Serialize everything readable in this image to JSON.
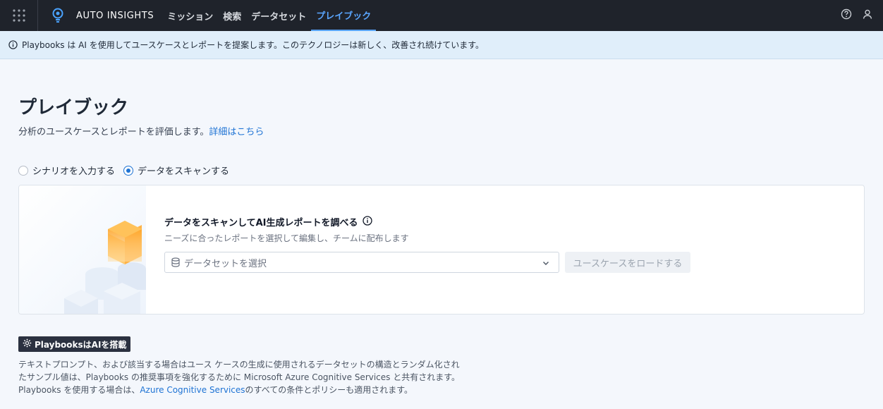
{
  "nav": {
    "brand": "AUTO INSIGHTS",
    "links": [
      "ミッション",
      "検索",
      "データセット",
      "プレイブック"
    ],
    "active_index": 3,
    "icons": [
      "apps-grid-icon",
      "lightbulb-logo-icon",
      "help-icon",
      "user-icon"
    ]
  },
  "banner": {
    "text": "Playbooks は AI を使用してユースケースとレポートを提案します。このテクノロジーは新しく、改善され続けています。"
  },
  "page": {
    "title": "プレイブック",
    "subtitle": "分析のユースケースとレポートを評価します。",
    "subtitle_link": "詳細はこちら"
  },
  "mode": {
    "options": [
      "シナリオを入力する",
      "データをスキャンする"
    ],
    "selected": 1
  },
  "scan_card": {
    "title": "データをスキャンしてAI生成レポートを調べる",
    "subtitle": "ニーズに合ったレポートを選択して編集し、チームに配布します",
    "dataset_placeholder": "データセットを選択",
    "load_button": "ユースケースをロードする"
  },
  "ai_notice": {
    "badge": "PlaybooksはAIを搭載",
    "line1": "テキストプロンプト、および該当する場合はユース ケースの生成に使用されるデータセットの構造とランダム化され",
    "line2": "たサンプル値は、Playbooks の推奨事項を強化するために Microsoft Azure Cognitive Services と共有されます。",
    "line3_prefix": "Playbooks を使用する場合は、",
    "line3_link": "Azure Cognitive Services",
    "line3_suffix": "のすべての条件とポリシーも適用されます。"
  },
  "colors": {
    "nav_bg": "#1f232b",
    "accent": "#1e73d4",
    "nav_active": "#5aa6ff",
    "banner_bg": "#e0eefa"
  }
}
